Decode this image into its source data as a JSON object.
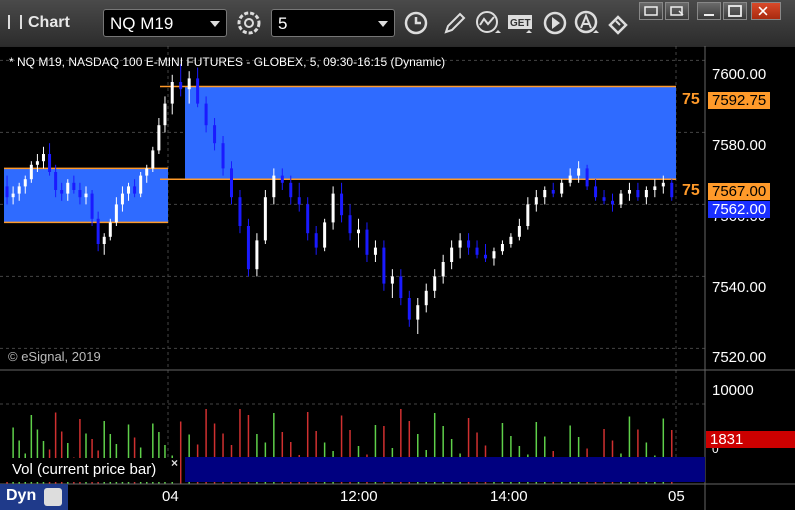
{
  "toolbar": {
    "title": "Chart",
    "symbol": "NQ M19",
    "interval": "5",
    "icons": [
      "settings-gear-icon",
      "clock-icon",
      "pencil-icon",
      "studies-icon",
      "get-icon",
      "play-icon",
      "alert-icon",
      "link-icon"
    ],
    "window": [
      "restore-icon",
      "popout-icon",
      "maximize-icon",
      "close-icon"
    ]
  },
  "chart": {
    "header": "* NQ M19, NASDAQ 100 E-MINI FUTURES - GLOBEX, 5, 09:30-16:15 (Dynamic)",
    "watermark": "© eSignal, 2019",
    "price_ticks": [
      "7600.00",
      "7580.00",
      "7560.00",
      "7540.00",
      "7520.00"
    ],
    "volume_ticks": [
      "10000",
      "0"
    ],
    "price_tags": [
      {
        "label": "75",
        "value": "7592.75",
        "bg": "#ff9a2a",
        "fg": "#000"
      },
      {
        "label": "75",
        "value": "7567.00",
        "bg": "#ff9a2a",
        "fg": "#000"
      },
      {
        "label": "",
        "value": "7562.00",
        "bg": "#1a2fff",
        "fg": "#fff"
      }
    ],
    "volume_tag": {
      "value": "1831",
      "bg": "#cc0000",
      "fg": "#fff"
    },
    "time_labels": [
      "04",
      "12:00",
      "14:00",
      "05"
    ],
    "volume_study_label": "Vol (current price bar)",
    "close_glyph": "×",
    "mode_label": "Dyn",
    "colors": {
      "up": "#ffffff",
      "down": "#1a1aff",
      "zone": "#2f6bff",
      "zone_line": "#ff9a2a",
      "vol_up": "#5fd04a",
      "vol_down": "#d03030"
    }
  },
  "chart_data": {
    "type": "candlestick",
    "title": "* NQ M19, NASDAQ 100 E-MINI FUTURES - GLOBEX, 5, 09:30-16:15 (Dynamic)",
    "ylim": [
      7514,
      7604
    ],
    "zones": [
      {
        "from": 7555,
        "to": 7570,
        "session": "first"
      },
      {
        "from": 7567,
        "to": 7592.75,
        "session": "second"
      }
    ],
    "prior_session_candles": [
      [
        7565,
        7568,
        7560,
        7562
      ],
      [
        7562,
        7565,
        7560,
        7563
      ],
      [
        7563,
        7566,
        7561,
        7565
      ],
      [
        7565,
        7568,
        7563,
        7567
      ],
      [
        7567,
        7572,
        7566,
        7571
      ],
      [
        7571,
        7574,
        7569,
        7572
      ],
      [
        7572,
        7576,
        7570,
        7574
      ],
      [
        7574,
        7577,
        7568,
        7569
      ],
      [
        7569,
        7571,
        7562,
        7564
      ],
      [
        7564,
        7566,
        7561,
        7563
      ],
      [
        7563,
        7567,
        7561,
        7566
      ],
      [
        7566,
        7568,
        7563,
        7564
      ],
      [
        7564,
        7566,
        7560,
        7562
      ],
      [
        7562,
        7565,
        7560,
        7563
      ],
      [
        7563,
        7564,
        7554,
        7556
      ],
      [
        7556,
        7558,
        7547,
        7549
      ],
      [
        7549,
        7552,
        7546,
        7551
      ],
      [
        7551,
        7556,
        7550,
        7555
      ],
      [
        7555,
        7562,
        7554,
        7560
      ],
      [
        7560,
        7565,
        7558,
        7563
      ],
      [
        7563,
        7566,
        7561,
        7565
      ],
      [
        7565,
        7567,
        7562,
        7563
      ],
      [
        7563,
        7569,
        7562,
        7568
      ],
      [
        7568,
        7571,
        7566,
        7570
      ],
      [
        7570,
        7576,
        7569,
        7575
      ],
      [
        7575,
        7584,
        7574,
        7582
      ],
      [
        7582,
        7590,
        7580,
        7588
      ]
    ],
    "session_candles": [
      [
        7588,
        7596,
        7585,
        7594
      ],
      [
        7594,
        7599,
        7590,
        7592
      ],
      [
        7592,
        7597,
        7588,
        7595
      ],
      [
        7595,
        7598,
        7587,
        7588
      ],
      [
        7588,
        7590,
        7580,
        7582
      ],
      [
        7582,
        7584,
        7575,
        7577
      ],
      [
        7577,
        7579,
        7568,
        7570
      ],
      [
        7570,
        7572,
        7560,
        7562
      ],
      [
        7562,
        7564,
        7552,
        7554
      ],
      [
        7554,
        7556,
        7540,
        7542
      ],
      [
        7542,
        7552,
        7540,
        7550
      ],
      [
        7550,
        7564,
        7549,
        7562
      ],
      [
        7562,
        7570,
        7560,
        7568
      ],
      [
        7568,
        7570,
        7564,
        7566
      ],
      [
        7566,
        7568,
        7560,
        7562
      ],
      [
        7562,
        7566,
        7558,
        7560
      ],
      [
        7560,
        7562,
        7550,
        7552
      ],
      [
        7552,
        7554,
        7546,
        7548
      ],
      [
        7548,
        7556,
        7547,
        7555
      ],
      [
        7555,
        7565,
        7553,
        7563
      ],
      [
        7563,
        7566,
        7555,
        7557
      ],
      [
        7557,
        7560,
        7550,
        7552
      ],
      [
        7552,
        7556,
        7548,
        7553
      ],
      [
        7553,
        7555,
        7544,
        7546
      ],
      [
        7546,
        7550,
        7544,
        7548
      ],
      [
        7548,
        7550,
        7536,
        7538
      ],
      [
        7538,
        7542,
        7534,
        7540
      ],
      [
        7540,
        7542,
        7532,
        7534
      ],
      [
        7534,
        7536,
        7526,
        7528
      ],
      [
        7528,
        7534,
        7524,
        7532
      ],
      [
        7532,
        7538,
        7530,
        7536
      ],
      [
        7536,
        7542,
        7534,
        7540
      ],
      [
        7540,
        7546,
        7538,
        7544
      ],
      [
        7544,
        7550,
        7542,
        7548
      ],
      [
        7548,
        7552,
        7545,
        7550
      ],
      [
        7550,
        7552,
        7546,
        7548
      ],
      [
        7548,
        7550,
        7545,
        7546
      ],
      [
        7546,
        7549,
        7544,
        7545
      ],
      [
        7545,
        7548,
        7543,
        7547
      ],
      [
        7547,
        7550,
        7546,
        7549
      ],
      [
        7549,
        7552,
        7548,
        7551
      ],
      [
        7551,
        7556,
        7550,
        7554
      ],
      [
        7554,
        7562,
        7553,
        7560
      ],
      [
        7560,
        7564,
        7558,
        7562
      ],
      [
        7562,
        7565,
        7560,
        7564
      ],
      [
        7564,
        7566,
        7562,
        7563
      ],
      [
        7563,
        7567,
        7562,
        7566
      ],
      [
        7566,
        7570,
        7565,
        7568
      ],
      [
        7568,
        7572,
        7566,
        7570
      ],
      [
        7570,
        7571,
        7564,
        7565
      ],
      [
        7565,
        7567,
        7561,
        7562
      ],
      [
        7562,
        7564,
        7560,
        7561
      ],
      [
        7561,
        7563,
        7558,
        7560
      ],
      [
        7560,
        7564,
        7559,
        7563
      ],
      [
        7563,
        7566,
        7561,
        7564
      ],
      [
        7564,
        7566,
        7561,
        7562
      ],
      [
        7562,
        7565,
        7560,
        7564
      ],
      [
        7564,
        7567,
        7562,
        7565
      ],
      [
        7565,
        7568,
        7563,
        7566
      ],
      [
        7566,
        7567,
        7561,
        7562
      ]
    ],
    "volume_max": 10000,
    "volume_last": 1831
  }
}
